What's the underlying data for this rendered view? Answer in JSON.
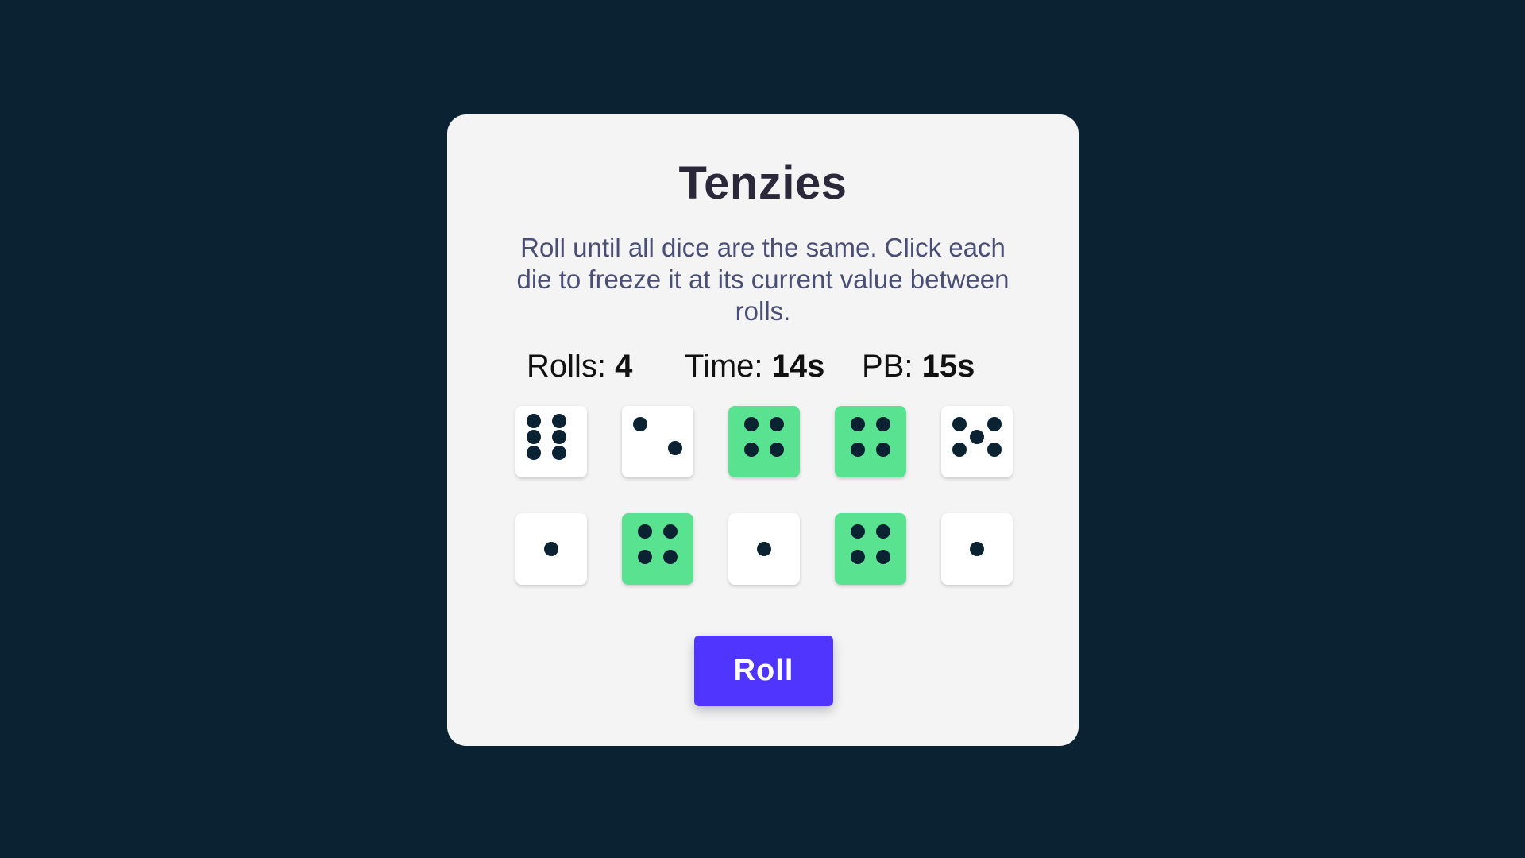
{
  "game": {
    "title": "Tenzies",
    "instructions": "Roll until all dice are the same. Click each die to freeze it at its current value between rolls.",
    "stats": {
      "rolls_label": "Rolls:",
      "rolls_value": "4",
      "time_label": "Time:",
      "time_value": "14s",
      "pb_label": "PB:",
      "pb_value": "15s"
    },
    "dice": [
      {
        "value": 6,
        "held": false
      },
      {
        "value": 2,
        "held": false
      },
      {
        "value": 4,
        "held": true
      },
      {
        "value": 4,
        "held": true
      },
      {
        "value": 5,
        "held": false
      },
      {
        "value": 1,
        "held": false
      },
      {
        "value": 4,
        "held": true
      },
      {
        "value": 1,
        "held": false
      },
      {
        "value": 4,
        "held": true
      },
      {
        "value": 1,
        "held": false
      }
    ],
    "roll_button_label": "Roll"
  },
  "colors": {
    "background": "#0b2233",
    "card": "#f4f4f5",
    "held_die": "#59e391",
    "die": "#ffffff",
    "pip": "#0b2233",
    "button": "#5035ff"
  }
}
